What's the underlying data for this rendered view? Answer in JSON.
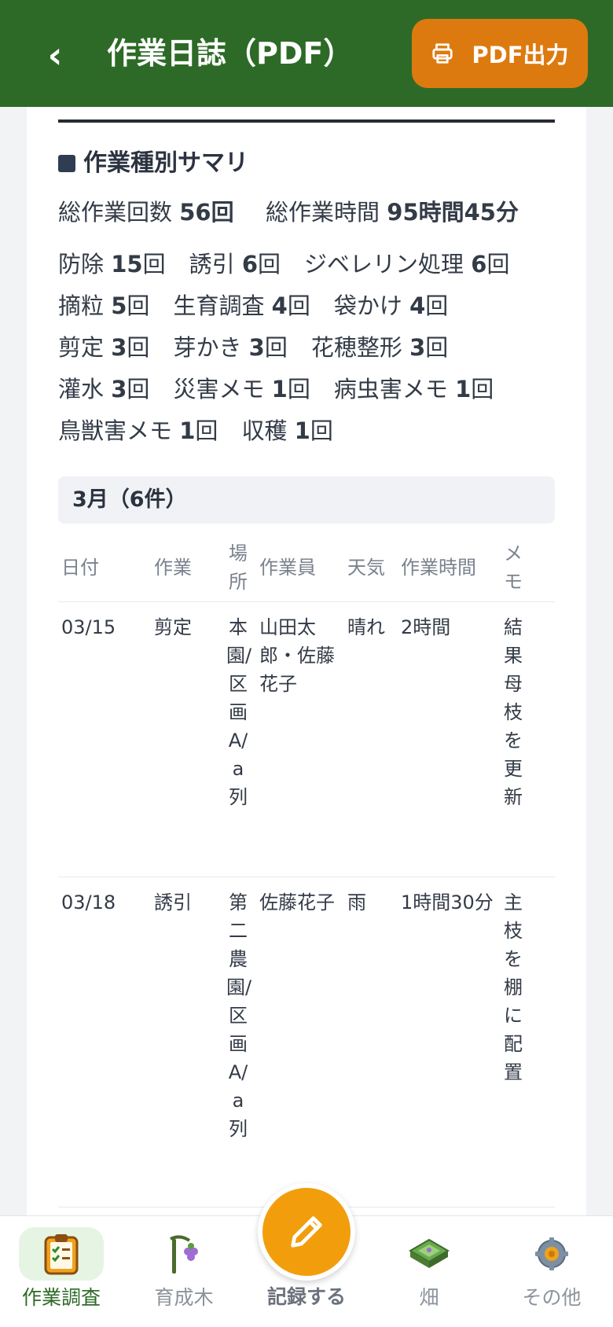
{
  "header": {
    "back": "‹",
    "title": "作業日誌（PDF）",
    "pdf_button": "PDF出力"
  },
  "summary": {
    "title": "作業種別サマリ",
    "total_count_label": "総作業回数",
    "total_count": "56回",
    "total_time_label": "総作業時間",
    "total_time": "95時間45分",
    "counts": [
      {
        "name": "防除",
        "count": "15",
        "unit": "回"
      },
      {
        "name": "誘引",
        "count": "6",
        "unit": "回"
      },
      {
        "name": "ジベレリン処理",
        "count": "6",
        "unit": "回"
      },
      {
        "name": "摘粒",
        "count": "5",
        "unit": "回"
      },
      {
        "name": "生育調査",
        "count": "4",
        "unit": "回"
      },
      {
        "name": "袋かけ",
        "count": "4",
        "unit": "回"
      },
      {
        "name": "剪定",
        "count": "3",
        "unit": "回"
      },
      {
        "name": "芽かき",
        "count": "3",
        "unit": "回"
      },
      {
        "name": "花穂整形",
        "count": "3",
        "unit": "回"
      },
      {
        "name": "灌水",
        "count": "3",
        "unit": "回"
      },
      {
        "name": "災害メモ",
        "count": "1",
        "unit": "回"
      },
      {
        "name": "病虫害メモ",
        "count": "1",
        "unit": "回"
      },
      {
        "name": "鳥獣害メモ",
        "count": "1",
        "unit": "回"
      },
      {
        "name": "収穫",
        "count": "1",
        "unit": "回"
      }
    ]
  },
  "month": {
    "label": "3月（6件）"
  },
  "table": {
    "headers": {
      "date": "日付",
      "work": "作業",
      "place": "場所",
      "worker": "作業員",
      "weather": "天気",
      "time": "作業時間",
      "memo": "メモ"
    },
    "rows": [
      {
        "date": "03/15",
        "work": "剪定",
        "place": "本園/区画A/a列",
        "worker": "山田太郎・佐藤花子",
        "weather": "晴れ",
        "time": "2時間",
        "memo": "結果母枝を更新"
      },
      {
        "date": "03/18",
        "work": "誘引",
        "place": "第二農園/区画A/a列",
        "worker": "佐藤花子",
        "weather": "雨",
        "time": "1時間30分",
        "memo": "主枝を棚に配置"
      }
    ]
  },
  "nav": {
    "items": [
      {
        "label": "作業調査",
        "icon": "clipboard-check-icon"
      },
      {
        "label": "育成木",
        "icon": "grape-tree-icon"
      },
      {
        "label": "畑",
        "icon": "field-icon"
      },
      {
        "label": "その他",
        "icon": "gear-icon"
      }
    ],
    "fab_label": "記録する",
    "fab_icon": "pencil-icon"
  },
  "colors": {
    "header": "#2e6a27",
    "pdf_button": "#dd7a0f",
    "fab": "#f29e0c",
    "active_nav_bg": "#e6f4e4"
  }
}
